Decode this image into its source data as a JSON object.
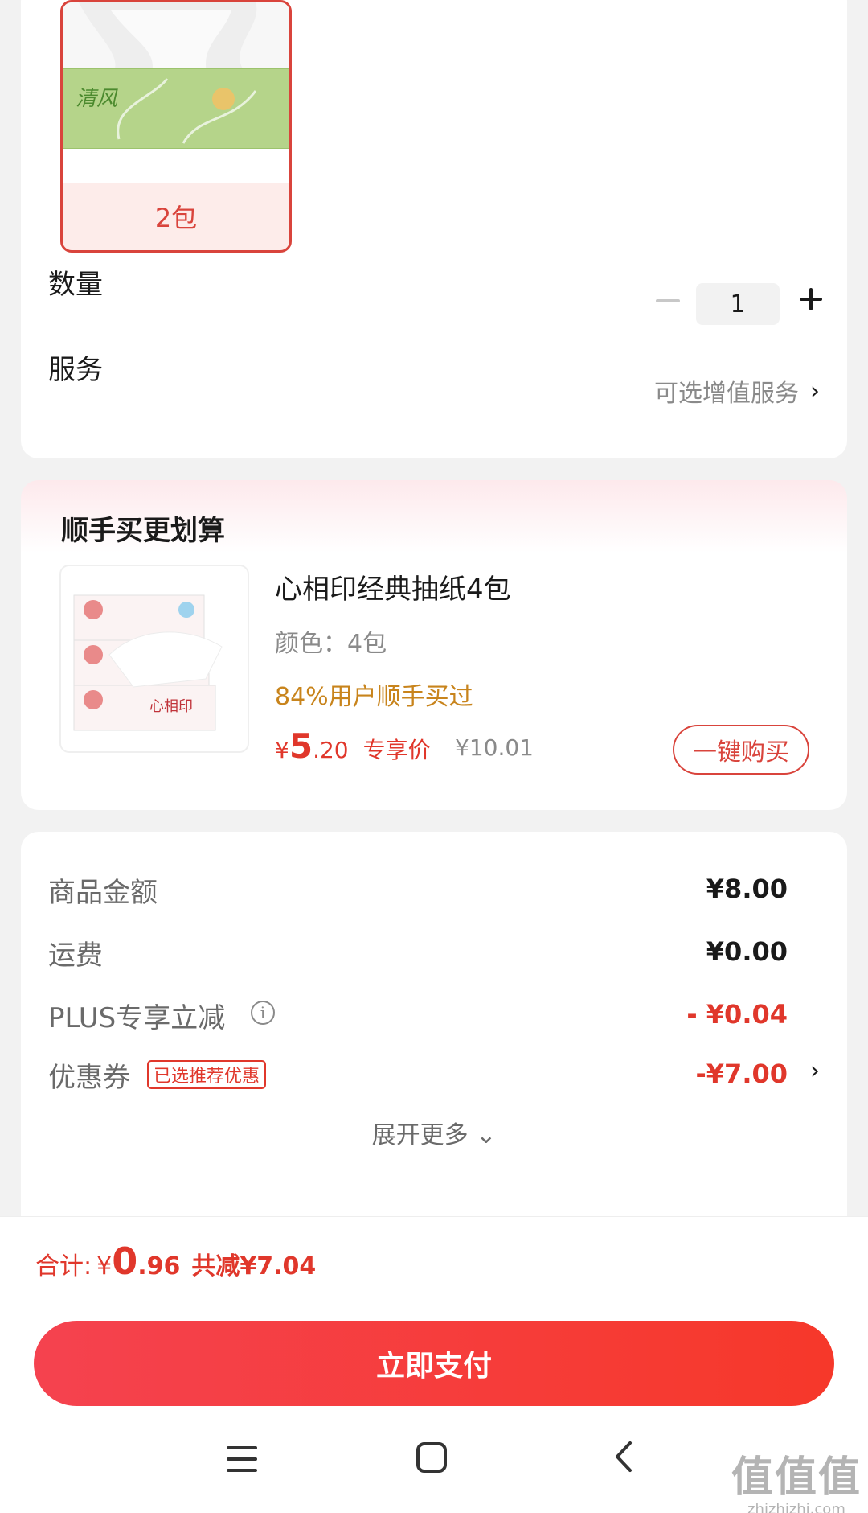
{
  "sku": {
    "option_label": "2包",
    "qty_label": "数量",
    "qty_value": "1",
    "service_label": "服务",
    "service_link": "可选增值服务",
    "chevron": "›"
  },
  "recommend": {
    "title": "顺手买更划算",
    "product_name": "心相印经典抽纸4包",
    "color_text": "颜色：4包",
    "social_proof": "84%用户顺手买过",
    "price_currency": "¥",
    "price_int": "5",
    "price_dec": ".20",
    "price_tag": "专享价",
    "original_price": "¥10.01",
    "buy_button": "一键购买"
  },
  "summary": {
    "rows": [
      {
        "label": "商品金额",
        "value": "¥8.00"
      },
      {
        "label": "运费",
        "value": "¥0.00"
      },
      {
        "label": "PLUS专享立减",
        "value": "- ¥0.04"
      },
      {
        "label": "优惠券",
        "value": "-¥7.00"
      }
    ],
    "info_glyph": "i",
    "coupon_badge": "已选推荐优惠",
    "expand_label": "展开更多 ⌄"
  },
  "total": {
    "label": "合计:",
    "currency": "¥",
    "int": "0",
    "dec": ".96",
    "saved": "共减¥7.04"
  },
  "pay_button": "立即支付",
  "watermark": {
    "big": "值值值",
    "small": "zhizhizhi.com"
  },
  "colors": {
    "accent": "#e0372b",
    "social": "#c8841c",
    "pay_start": "#f5424f",
    "pay_end": "#f6382a"
  },
  "icons": [
    "minus-icon",
    "plus-icon",
    "chevron-right-icon",
    "info-icon",
    "chevron-down-icon",
    "menu-icon",
    "home-icon",
    "back-icon"
  ]
}
